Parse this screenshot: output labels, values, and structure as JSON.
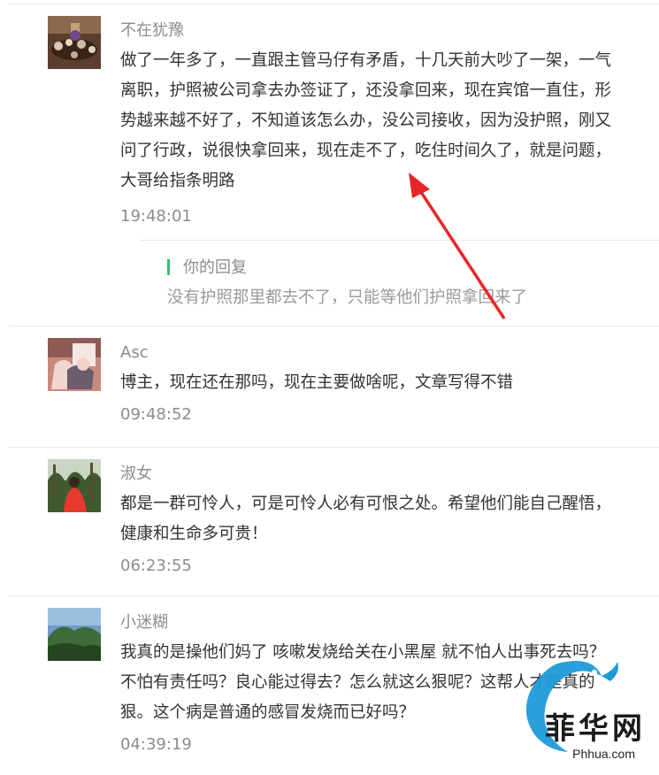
{
  "comments": [
    {
      "name": "不在犹豫",
      "text": "做了一年多了，一直跟主管马仔有矛盾，十几天前大吵了一架，一气离职，护照被公司拿去办签证了，还没拿回来，现在宾馆一直住，形势越来越不好了，不知道该怎么办，没公司接收，因为没护照，刚又问了行政，说很快拿回来，现在走不了，吃住时间久了，就是问题，大哥给指条明路",
      "time": "19:48:01",
      "reply": {
        "label": "你的回复",
        "text": "没有护照那里都去不了，只能等他们护照拿回来了"
      }
    },
    {
      "name": "Asc",
      "text": "博主，现在还在那吗，现在主要做啥呢，文章写得不错",
      "time": "09:48:52"
    },
    {
      "name": "淑女",
      "text": "都是一群可怜人，可是可怜人必有可恨之处。希望他们能自己醒悟，健康和生命多可贵！",
      "time": "06:23:55"
    },
    {
      "name": "小迷糊",
      "text": "我真的是操他们妈了 咳嗽发烧给关在小黑屋 就不怕人出事死去吗？不怕有责任吗？良心能过得去？怎么就这么狠呢？这帮人才是真的狠。这个病是普通的感冒发烧而已好吗？",
      "time": "04:39:19"
    }
  ],
  "watermark": {
    "title": "菲华网",
    "url": "Phhua.com"
  },
  "colors": {
    "name": "#8c8c8c",
    "text": "#333333",
    "reply_bar": "#3cbd6a",
    "arrow": "#e8262a"
  }
}
